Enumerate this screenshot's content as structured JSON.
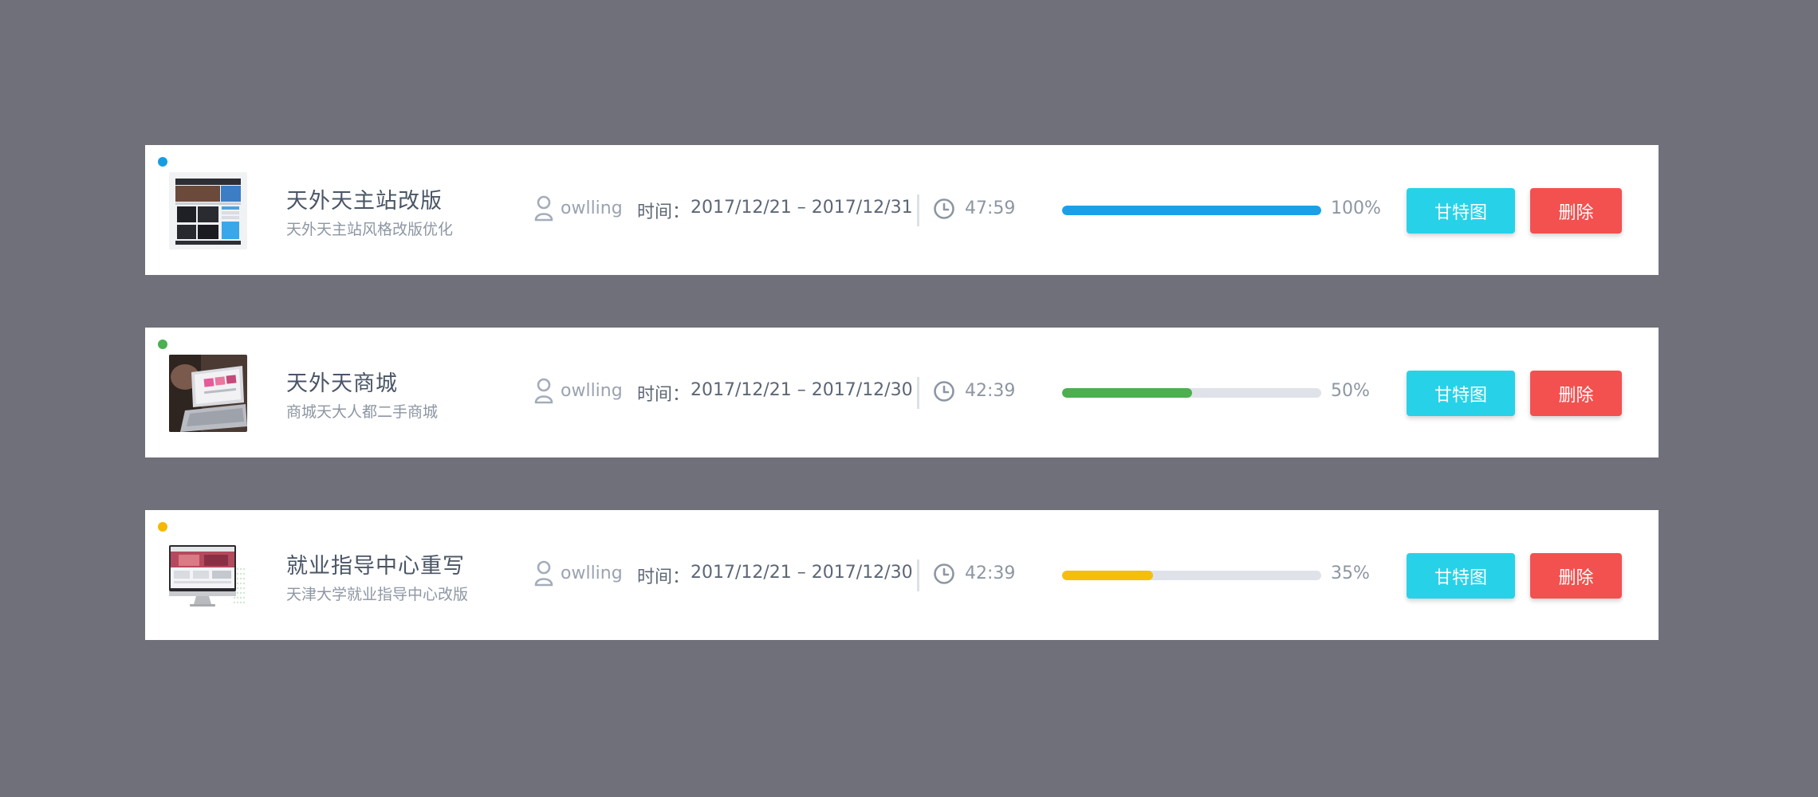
{
  "projects": [
    {
      "title": "天外天主站改版",
      "subtitle": "天外天主站风格改版优化",
      "owner": "owlling",
      "time_label": "时间：",
      "time_range": "2017/12/21 – 2017/12/31",
      "duration": "47:59",
      "progress": 1.0,
      "progress_label": "100%",
      "status_color": "#1a9be0",
      "progress_color": "#1aa0e8",
      "thumbnail": "website-screenshot",
      "gantt_label": "甘特图",
      "delete_label": "删除"
    },
    {
      "title": "天外天商城",
      "subtitle": "商城天大人都二手商城",
      "owner": "owlling",
      "time_label": "时间：",
      "time_range": "2017/12/21 – 2017/12/30",
      "duration": "42:39",
      "progress": 0.5,
      "progress_label": "50%",
      "status_color": "#4caf50",
      "progress_color": "#4caf50",
      "thumbnail": "laptop-photo",
      "gantt_label": "甘特图",
      "delete_label": "删除"
    },
    {
      "title": "就业指导中心重写",
      "subtitle": "天津大学就业指导中心改版",
      "owner": "owlling",
      "time_label": "时间：",
      "time_range": "2017/12/21 – 2017/12/30",
      "duration": "42:39",
      "progress": 0.35,
      "progress_label": "35%",
      "status_color": "#f5b800",
      "progress_color": "#f5be0b",
      "thumbnail": "monitor-mockup",
      "gantt_label": "甘特图",
      "delete_label": "删除"
    }
  ]
}
